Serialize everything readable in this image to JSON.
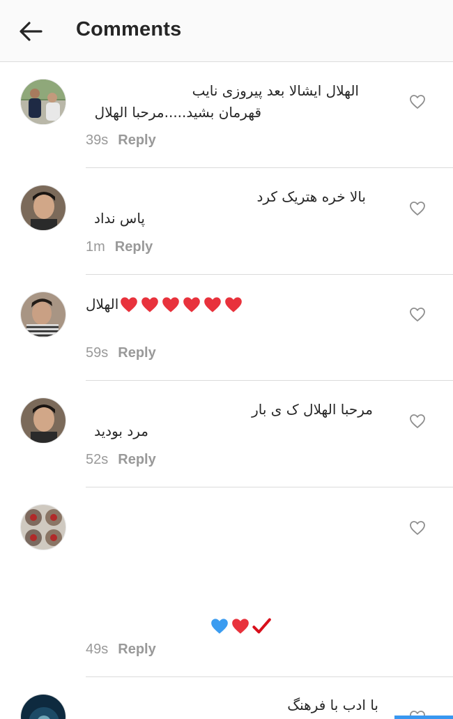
{
  "header": {
    "title": "Comments",
    "back_icon": "arrow-left-icon"
  },
  "colors": {
    "text": "#262626",
    "meta": "#999999",
    "divider": "#dbdbdb",
    "heart_red": "#e8323c",
    "heart_blue": "#3b9cf0",
    "check_red": "#d8101c"
  },
  "comments": [
    {
      "line1": "الهلال ایشالا بعد پیروزی نایب",
      "line2": "قهرمان بشید.....مرحبا الهلال",
      "time": "39s",
      "reply": "Reply"
    },
    {
      "line1": "بالا خره هتریک کرد",
      "line2": "پاس نداد",
      "time": "1m",
      "reply": "Reply"
    },
    {
      "line1": "الهلال",
      "emoji": "red-hearts x6",
      "time": "59s",
      "reply": "Reply"
    },
    {
      "line1": "مرحبا الهلال ک ی بار",
      "line2": "مرد بودید",
      "time": "52s",
      "reply": "Reply"
    },
    {
      "emoji": "check, red heart, blue heart",
      "time": "49s",
      "reply": "Reply"
    },
    {
      "line1": "با ادب با فرهنگ"
    }
  ]
}
